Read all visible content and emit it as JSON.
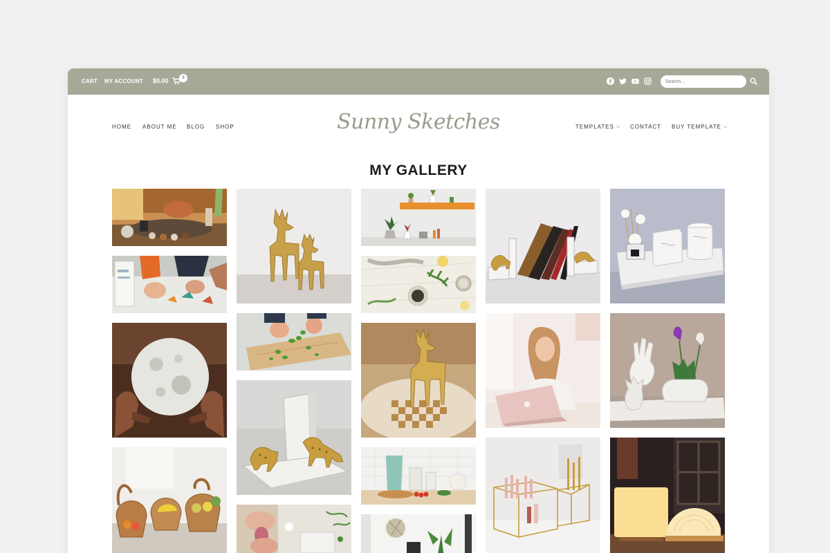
{
  "topbar": {
    "cart_label": "CART",
    "account_label": "MY ACCOUNT",
    "cart_total": "$0.00",
    "cart_count": "0",
    "search_placeholder": "Search...",
    "social_icons": [
      "facebook-icon",
      "twitter-icon",
      "youtube-icon",
      "instagram-icon"
    ],
    "background_color": "#a7a998"
  },
  "nav": {
    "left": [
      "HOME",
      "ABOUT ME",
      "BLOG",
      "SHOP"
    ],
    "right": [
      "TEMPLATES",
      "CONTACT",
      "BUY TEMPLATE"
    ]
  },
  "logo": "Sunny Sketches",
  "gallery": {
    "title": "MY GALLERY",
    "photos": [
      "crafting-workshop-photo",
      "origami-craft-photo",
      "moon-lamp-photo",
      "wicker-baskets-photo",
      "golden-deer-pair-photo",
      "herb-cutting-board-photo",
      "marble-leopard-bookend-photo",
      "hands-crafting-photo",
      "wall-shelf-plants-photo",
      "herbs-flatlay-photo",
      "golden-deer-chessboard-photo",
      "kitchen-counter-photo",
      "desk-plants-photo",
      "bookends-books-photo",
      "woman-laptop-photo",
      "gold-glass-organizer-photo",
      "marble-candle-tray-photo",
      "hand-vases-tulips-photo",
      "book-lamp-photo"
    ]
  }
}
